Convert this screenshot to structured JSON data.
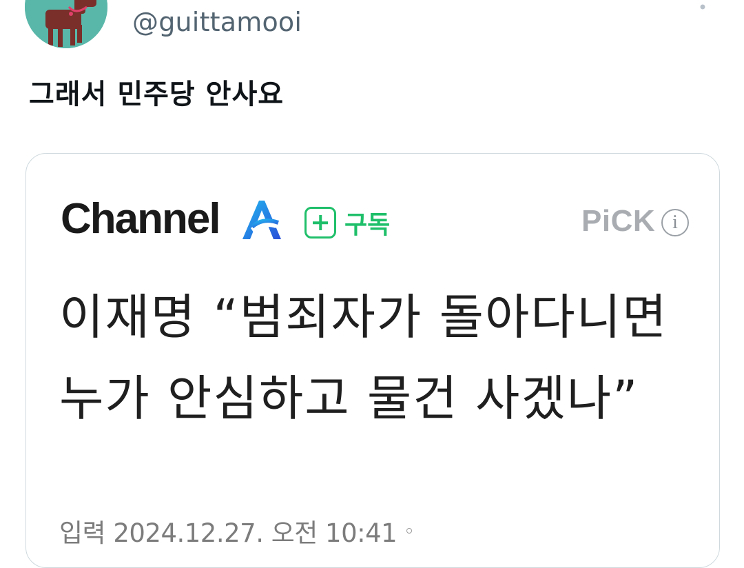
{
  "tweet": {
    "handle": "@guittamooi",
    "text": "그래서 민주당 안사요"
  },
  "card": {
    "brand": "Channel",
    "subscribe_label": "구독",
    "pick_label": "PiCK",
    "info_label": "i",
    "headline": "이재명 “범죄자가 돌아다니면 누가 안심하고 물건 사겠나”",
    "date": "입력 2024.12.27. 오전 10:41"
  },
  "colors": {
    "avatar_bg": "#59b7a9",
    "subscribe_green": "#1fbf6a",
    "brand_a_blue": "#2a6cf0"
  }
}
